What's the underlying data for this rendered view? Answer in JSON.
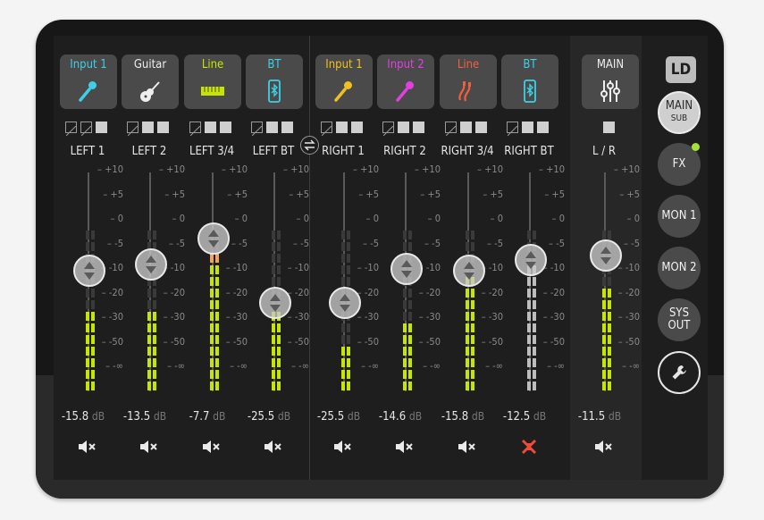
{
  "brand": {
    "logo": "LD"
  },
  "colors": {
    "meter_on": "#c6e600",
    "meter_peak": "#f3a35a",
    "mute_active": "#f04a3a"
  },
  "left_channels": [
    {
      "name": "Input 1",
      "name_color": "#3ed0e6",
      "icon": "microphone-icon",
      "icon_color": "#3ed0e6",
      "label": "LEFT 1",
      "db": "-15.8",
      "routing": [
        false,
        false,
        true
      ],
      "fader_level": 0.55,
      "meter": [
        1,
        1,
        1,
        1,
        1,
        1,
        1,
        0,
        0,
        0,
        0,
        0,
        0,
        0
      ],
      "mute": false
    },
    {
      "name": "Guitar",
      "name_color": "#eeeeee",
      "icon": "guitar-icon",
      "icon_color": "#eeeeee",
      "label": "LEFT 2",
      "db": "-13.5",
      "routing": [
        false,
        true,
        true
      ],
      "fader_level": 0.58,
      "meter": [
        1,
        1,
        1,
        1,
        1,
        1,
        1,
        0,
        0,
        0,
        0,
        0,
        0,
        0
      ],
      "mute": false
    },
    {
      "name": "Line",
      "name_color": "#c6e600",
      "icon": "keyboard-icon",
      "icon_color": "#c6e600",
      "label": "LEFT 3/4",
      "db": "-7.7",
      "routing": [
        false,
        true,
        true
      ],
      "fader_level": 0.7,
      "meter": [
        1,
        1,
        1,
        1,
        1,
        1,
        1,
        1,
        1,
        1,
        1,
        2,
        0,
        0
      ],
      "mute": false
    },
    {
      "name": "BT",
      "name_color": "#3ed0e6",
      "icon": "bluetooth-phone-icon",
      "icon_color": "#3ed0e6",
      "label": "LEFT BT",
      "db": "-25.5",
      "routing": [
        false,
        true,
        true
      ],
      "fader_level": 0.4,
      "meter": [
        1,
        1,
        1,
        1,
        1,
        1,
        1,
        0,
        0,
        0,
        0,
        0,
        0,
        0
      ],
      "mute": false
    }
  ],
  "right_channels": [
    {
      "name": "Input 1",
      "name_color": "#f0c020",
      "icon": "microphone-icon",
      "icon_color": "#f0c020",
      "label": "RIGHT 1",
      "db": "-25.5",
      "routing": [
        false,
        true,
        true
      ],
      "fader_level": 0.4,
      "meter": [
        1,
        1,
        1,
        1,
        0,
        0,
        0,
        0,
        0,
        0,
        0,
        0,
        0,
        0
      ],
      "mute": false
    },
    {
      "name": "Input 2",
      "name_color": "#e040e0",
      "icon": "microphone-icon",
      "icon_color": "#e040e0",
      "label": "RIGHT 2",
      "db": "-14.6",
      "routing": [
        false,
        true,
        true
      ],
      "fader_level": 0.56,
      "meter": [
        1,
        1,
        1,
        1,
        1,
        1,
        0,
        0,
        0,
        0,
        0,
        0,
        0,
        0
      ],
      "mute": false
    },
    {
      "name": "Line",
      "name_color": "#f06040",
      "icon": "cable-icon",
      "icon_color": "#f06040",
      "label": "RIGHT 3/4",
      "db": "-15.8",
      "routing": [
        false,
        true,
        true
      ],
      "fader_level": 0.55,
      "meter": [
        1,
        1,
        1,
        1,
        1,
        1,
        1,
        1,
        1,
        1,
        0,
        0,
        0,
        0
      ],
      "mute": false
    },
    {
      "name": "BT",
      "name_color": "#3ed0e6",
      "icon": "bluetooth-phone-icon",
      "icon_color": "#3ed0e6",
      "label": "RIGHT BT",
      "db": "-12.5",
      "routing": [
        false,
        true,
        true
      ],
      "fader_level": 0.6,
      "meter": [
        3,
        3,
        3,
        3,
        3,
        3,
        3,
        3,
        3,
        3,
        3,
        0,
        0,
        0
      ],
      "mute": true
    }
  ],
  "main_channel": {
    "name": "MAIN",
    "icon": "sliders-icon",
    "label": "L / R",
    "db": "-11.5",
    "fader_level": 0.62,
    "meter": [
      1,
      1,
      1,
      1,
      1,
      1,
      1,
      1,
      1,
      0,
      0,
      0,
      0,
      0
    ],
    "mute": false
  },
  "scale_ticks": [
    "+10",
    "+5",
    "0",
    "-5",
    "-10",
    "-20",
    "-30",
    "-50",
    "-∞"
  ],
  "db_unit": "dB",
  "side_nav": [
    {
      "id": "main",
      "line1": "MAIN",
      "line2": "SUB",
      "selected": true
    },
    {
      "id": "fx",
      "line1": "FX",
      "line2": "",
      "indicator": true
    },
    {
      "id": "mon1",
      "line1": "MON 1",
      "line2": ""
    },
    {
      "id": "mon2",
      "line1": "MON 2",
      "line2": ""
    },
    {
      "id": "sys",
      "line1": "SYS",
      "line2": "OUT"
    }
  ]
}
